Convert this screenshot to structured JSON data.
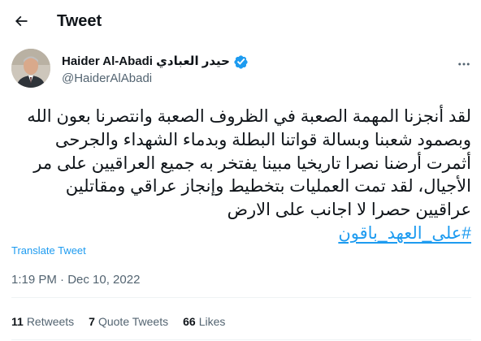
{
  "header": {
    "title": "Tweet"
  },
  "author": {
    "name": "Haider Al-Abadi حيدر العبادي",
    "handle": "@HaiderAlAbadi"
  },
  "tweet": {
    "text": "لقد أنجزنا المهمة الصعبة في الظروف الصعبة وانتصرنا بعون الله وبصمود شعبنا وبسالة قواتنا البطلة وبدماء الشهداء والجرحى أثمرت أرضنا نصرا تاريخيا مبينا يفتخر به جميع العراقيين على مر الأجيال، لقد تمت العمليات بتخطيط وإنجاز عراقي ومقاتلين عراقيين حصرا لا اجانب على الارض",
    "hashtag": "#على_العهد_باقون",
    "translate_label": "Translate Tweet",
    "timestamp": "1:19 PM · Dec 10, 2022"
  },
  "stats": {
    "retweets_count": "11",
    "retweets_label": "Retweets",
    "quotes_count": "7",
    "quotes_label": "Quote Tweets",
    "likes_count": "66",
    "likes_label": "Likes"
  },
  "colors": {
    "accent": "#1d9bf0",
    "muted": "#536471",
    "text": "#0f1419"
  }
}
